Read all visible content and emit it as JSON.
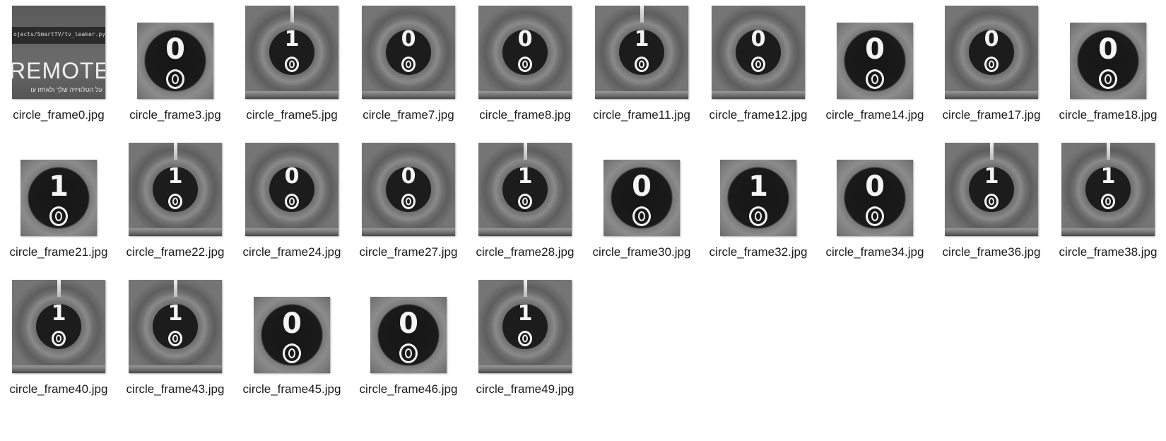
{
  "files": [
    {
      "name": "circle_frame0.jpg",
      "kind": "screen",
      "digit": ""
    },
    {
      "name": "circle_frame3.jpg",
      "kind": "small",
      "digit": "0"
    },
    {
      "name": "circle_frame5.jpg",
      "kind": "big",
      "digit": "1"
    },
    {
      "name": "circle_frame7.jpg",
      "kind": "big",
      "digit": "0"
    },
    {
      "name": "circle_frame8.jpg",
      "kind": "big",
      "digit": "0"
    },
    {
      "name": "circle_frame11.jpg",
      "kind": "big",
      "digit": "1"
    },
    {
      "name": "circle_frame12.jpg",
      "kind": "big",
      "digit": "0"
    },
    {
      "name": "circle_frame14.jpg",
      "kind": "small",
      "digit": "0"
    },
    {
      "name": "circle_frame17.jpg",
      "kind": "big",
      "digit": "0"
    },
    {
      "name": "circle_frame18.jpg",
      "kind": "small",
      "digit": "0"
    },
    {
      "name": "circle_frame21.jpg",
      "kind": "small",
      "digit": "1"
    },
    {
      "name": "circle_frame22.jpg",
      "kind": "big",
      "digit": "1"
    },
    {
      "name": "circle_frame24.jpg",
      "kind": "big",
      "digit": "0"
    },
    {
      "name": "circle_frame27.jpg",
      "kind": "big",
      "digit": "0"
    },
    {
      "name": "circle_frame28.jpg",
      "kind": "big",
      "digit": "1"
    },
    {
      "name": "circle_frame30.jpg",
      "kind": "small",
      "digit": "0"
    },
    {
      "name": "circle_frame32.jpg",
      "kind": "small",
      "digit": "1"
    },
    {
      "name": "circle_frame34.jpg",
      "kind": "small",
      "digit": "0"
    },
    {
      "name": "circle_frame36.jpg",
      "kind": "big",
      "digit": "1"
    },
    {
      "name": "circle_frame38.jpg",
      "kind": "big",
      "digit": "1"
    },
    {
      "name": "circle_frame40.jpg",
      "kind": "big",
      "digit": "1"
    },
    {
      "name": "circle_frame43.jpg",
      "kind": "big",
      "digit": "1"
    },
    {
      "name": "circle_frame45.jpg",
      "kind": "small",
      "digit": "0"
    },
    {
      "name": "circle_frame46.jpg",
      "kind": "small",
      "digit": "0"
    },
    {
      "name": "circle_frame49.jpg",
      "kind": "big",
      "digit": "1"
    }
  ],
  "screen_thumb": {
    "path_text": "ojects/SmartTV/tv_leaker.py",
    "big_text": "REMOTE A",
    "hebrew_text": "על הטלוויזיה שלך ולאחזו עו"
  }
}
